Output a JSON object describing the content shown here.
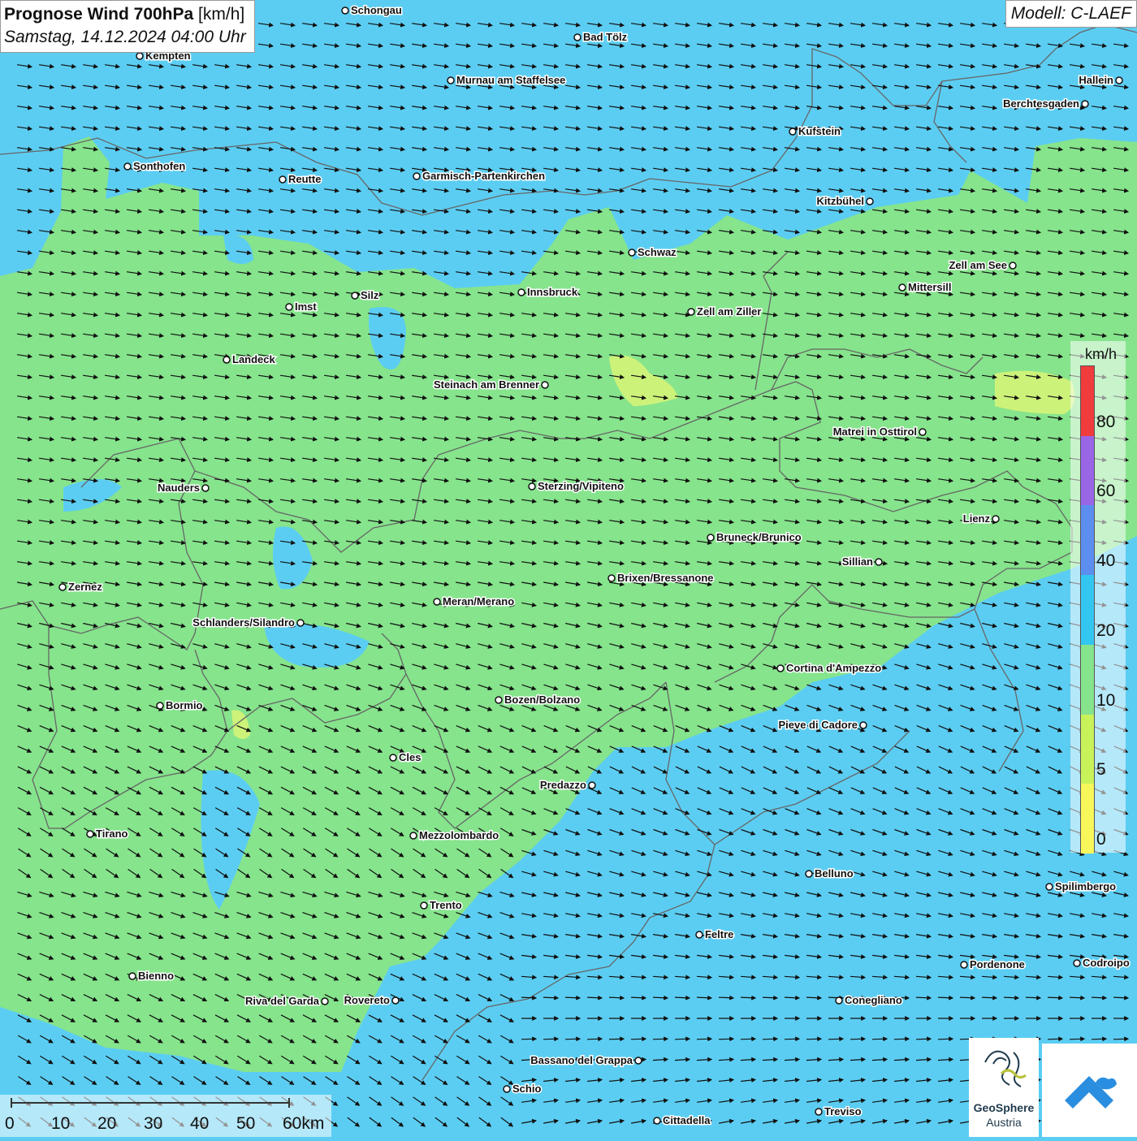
{
  "header": {
    "title_bold": "Prognose Wind 700hPa",
    "title_unit": "[km/h]",
    "subtitle": "Samstag, 14.12.2024 04:00 Uhr",
    "model": "Modell: C-LAEF"
  },
  "cities": [
    {
      "name": "Schongau"
    },
    {
      "name": "Bad Tölz"
    },
    {
      "name": "Kempten"
    },
    {
      "name": "Murnau am Staffelsee"
    },
    {
      "name": "Hallein"
    },
    {
      "name": "Berchtesgaden"
    },
    {
      "name": "Kufstein"
    },
    {
      "name": "Sonthofen"
    },
    {
      "name": "Reutte"
    },
    {
      "name": "Garmisch-Partenkirchen"
    },
    {
      "name": "Kitzbühel"
    },
    {
      "name": "Schwaz"
    },
    {
      "name": "Zell am See"
    },
    {
      "name": "Innsbruck"
    },
    {
      "name": "Mittersill"
    },
    {
      "name": "Silz"
    },
    {
      "name": "Imst"
    },
    {
      "name": "Zell am Ziller"
    },
    {
      "name": "Landeck"
    },
    {
      "name": "Steinach am Brenner"
    },
    {
      "name": "Matrei in Osttirol"
    },
    {
      "name": "Nauders"
    },
    {
      "name": "Sterzing/Vipiteno"
    },
    {
      "name": "Lienz"
    },
    {
      "name": "Bruneck/Brunico"
    },
    {
      "name": "Sillian"
    },
    {
      "name": "Brixen/Bressanone"
    },
    {
      "name": "Zernez"
    },
    {
      "name": "Meran/Merano"
    },
    {
      "name": "Schlanders/Silandro"
    },
    {
      "name": "Cortina d'Ampezzo"
    },
    {
      "name": "Bozen/Bolzano"
    },
    {
      "name": "Bormio"
    },
    {
      "name": "Pieve di Cadore"
    },
    {
      "name": "Cles"
    },
    {
      "name": "Predazzo"
    },
    {
      "name": "Tirano"
    },
    {
      "name": "Mezzolombardo"
    },
    {
      "name": "Belluno"
    },
    {
      "name": "Spilimbergo"
    },
    {
      "name": "Trento"
    },
    {
      "name": "Feltre"
    },
    {
      "name": "Bienno"
    },
    {
      "name": "Pordenone"
    },
    {
      "name": "Codroipo"
    },
    {
      "name": "Riva del Garda"
    },
    {
      "name": "Rovereto"
    },
    {
      "name": "Conegliano"
    },
    {
      "name": "Bassano del Grappa"
    },
    {
      "name": "Schio"
    },
    {
      "name": "Treviso"
    },
    {
      "name": "Cittadella"
    }
  ],
  "legend": {
    "unit": "km/h",
    "levels": [
      {
        "label": "80",
        "color": "#f03c3c"
      },
      {
        "label": "60",
        "color": "#9966e6"
      },
      {
        "label": "40",
        "color": "#5c8ef0"
      },
      {
        "label": "20",
        "color": "#33c6f0"
      },
      {
        "label": "10",
        "color": "#86e48c"
      },
      {
        "label": "5",
        "color": "#c8f25a"
      },
      {
        "label": "0",
        "color": "#f7f75c"
      }
    ]
  },
  "scalebar": {
    "labels": [
      "0",
      "10",
      "20",
      "30",
      "40",
      "50",
      "60km"
    ]
  },
  "logo": {
    "line1": "GeoSphere",
    "line2": "Austria"
  },
  "colors": {
    "wind_10_20": "#86e48c",
    "wind_20_40": "#5ccdf2",
    "wind_5_10": "#cdf27a",
    "arrow": "#111111",
    "border": "#666666"
  }
}
